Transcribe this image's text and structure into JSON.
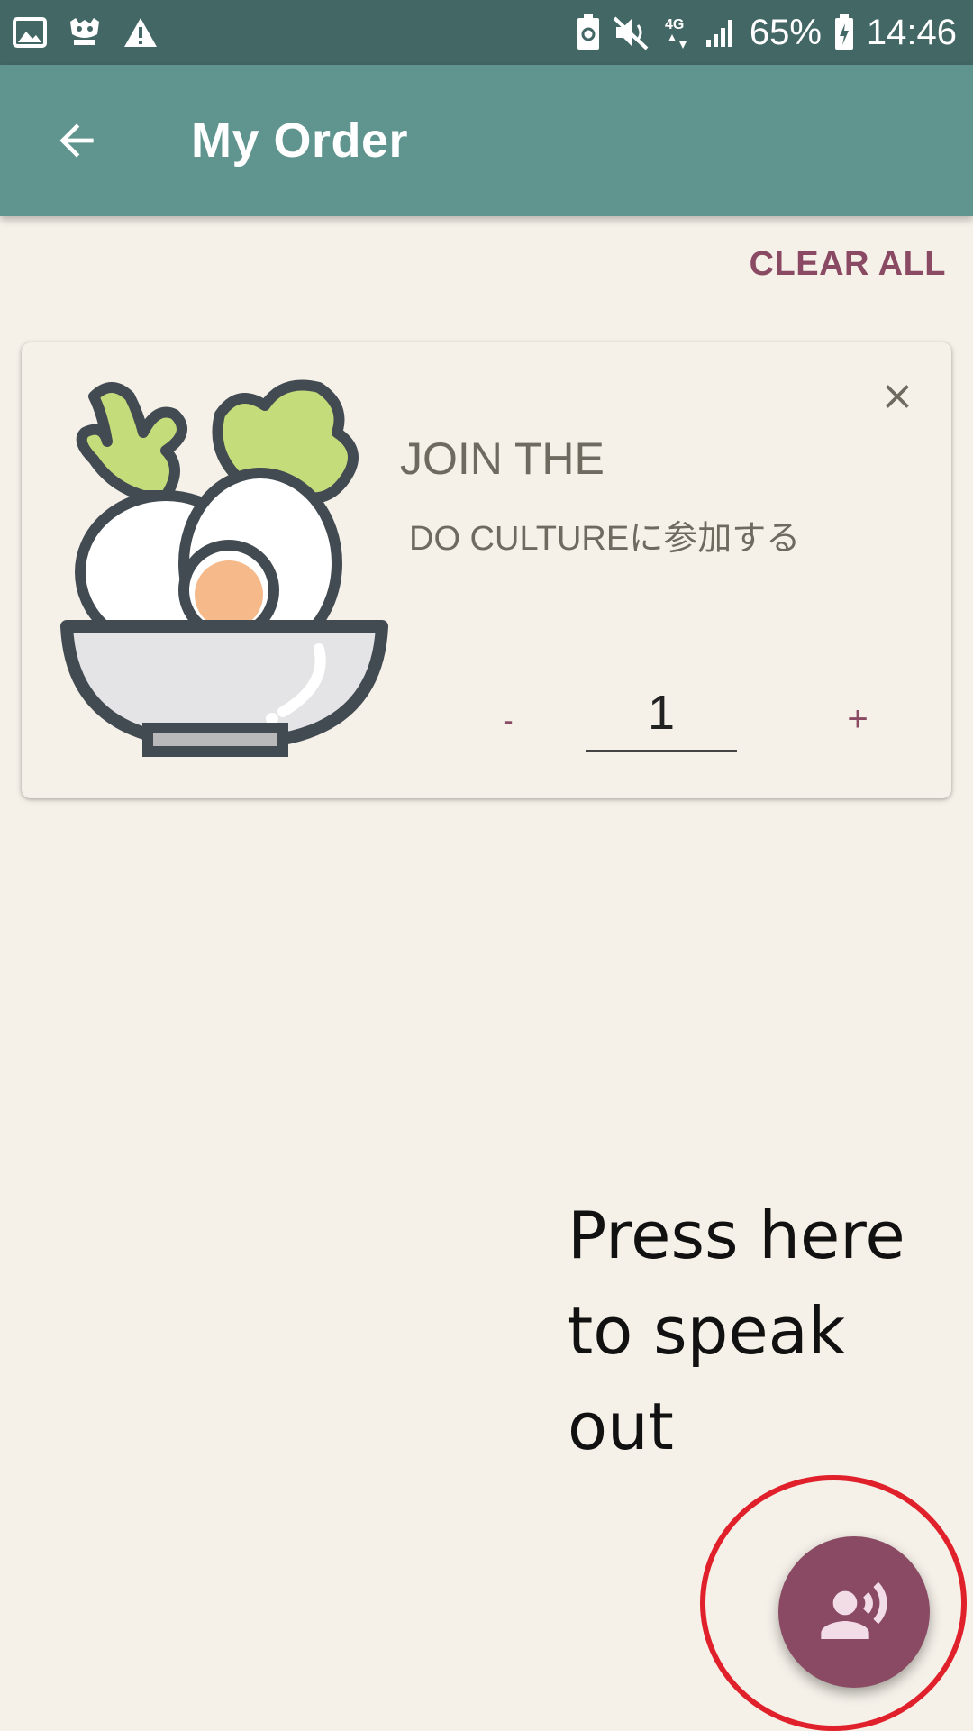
{
  "status_bar": {
    "battery_percent": "65%",
    "time": "14:46",
    "network": "4G"
  },
  "app_bar": {
    "title": "My Order"
  },
  "actions": {
    "clear_all": "CLEAR ALL"
  },
  "order_item": {
    "title": "JOIN THE",
    "subtitle": "DO CULTUREに参加する",
    "quantity": "1",
    "minus_label": "-",
    "plus_label": "+"
  },
  "hint": {
    "line1": "Press here",
    "line2": "to speak",
    "line3": "out"
  },
  "colors": {
    "status_bar": "#426765",
    "app_bar": "#5f958e",
    "accent": "#8a4a63",
    "background": "#f5f0e8",
    "highlight": "#e0202a"
  }
}
